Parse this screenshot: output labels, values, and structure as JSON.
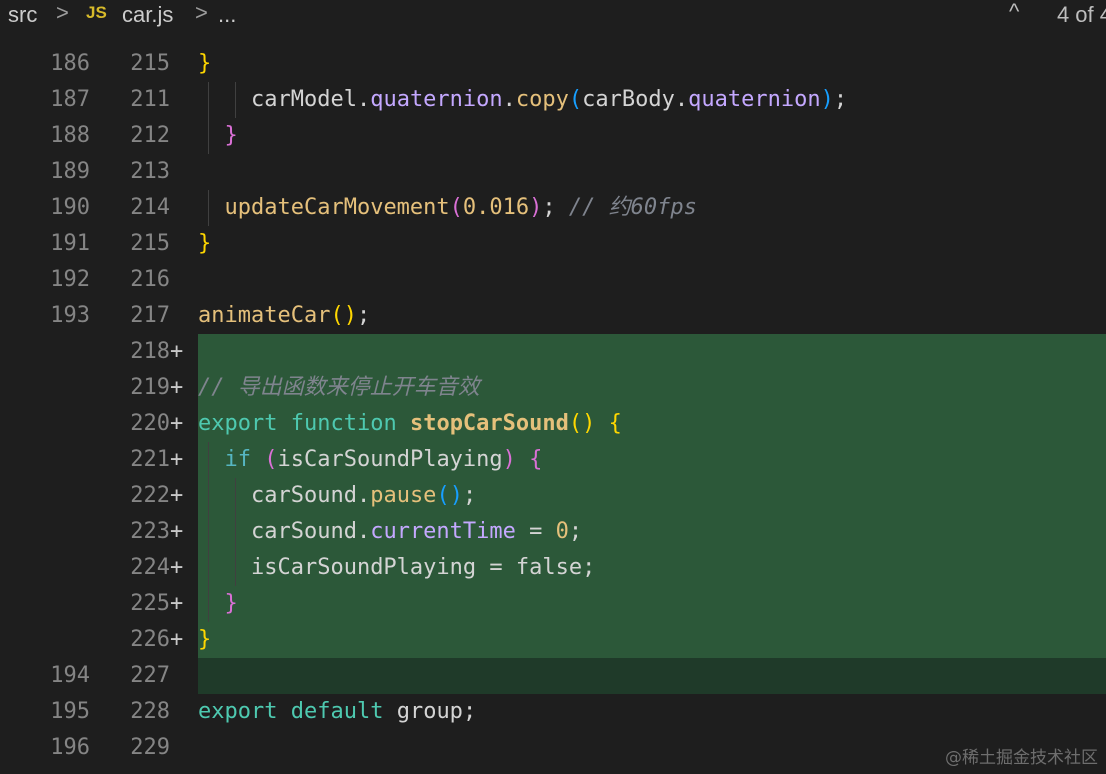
{
  "breadcrumb": {
    "folder": "src",
    "file_icon": "JS",
    "file": "car.js",
    "more": "...",
    "separator": ">"
  },
  "find": {
    "chevron": "^",
    "status": "4 of 4"
  },
  "lines": [
    {
      "old": "186",
      "new": "215",
      "added": false,
      "tokens": [
        [
          "}",
          "br1"
        ]
      ]
    },
    {
      "old": "187",
      "new": "211",
      "added": false,
      "indent": 2,
      "tokens": [
        [
          "carModel",
          "id"
        ],
        [
          ".",
          "id"
        ],
        [
          "quaternion",
          "prop"
        ],
        [
          ".",
          "id"
        ],
        [
          "copy",
          "fn"
        ],
        [
          "(",
          "br3"
        ],
        [
          "carBody",
          "id"
        ],
        [
          ".",
          "id"
        ],
        [
          "quaternion",
          "prop"
        ],
        [
          ")",
          "br3"
        ],
        [
          ";",
          "id"
        ]
      ]
    },
    {
      "old": "188",
      "new": "212",
      "added": false,
      "indent": 1,
      "tokens": [
        [
          "}",
          "br2"
        ]
      ]
    },
    {
      "old": "189",
      "new": "213",
      "added": false,
      "tokens": []
    },
    {
      "old": "190",
      "new": "214",
      "added": false,
      "indent": 1,
      "tokens": [
        [
          "updateCarMovement",
          "fn"
        ],
        [
          "(",
          "br2"
        ],
        [
          "0.016",
          "num"
        ],
        [
          ")",
          "br2"
        ],
        [
          "; ",
          "id"
        ],
        [
          "// 约60fps",
          "cmt"
        ]
      ]
    },
    {
      "old": "191",
      "new": "215",
      "added": false,
      "tokens": [
        [
          "}",
          "br1"
        ]
      ]
    },
    {
      "old": "192",
      "new": "216",
      "added": false,
      "tokens": []
    },
    {
      "old": "193",
      "new": "217",
      "added": false,
      "tokens": [
        [
          "animateCar",
          "fn"
        ],
        [
          "(",
          "br1"
        ],
        [
          ")",
          "br1"
        ],
        [
          ";",
          "id"
        ]
      ]
    },
    {
      "old": "",
      "new": "218",
      "added": true,
      "tokens": []
    },
    {
      "old": "",
      "new": "219",
      "added": true,
      "tokens": [
        [
          "// 导出函数来停止开车音效",
          "cmt"
        ]
      ]
    },
    {
      "old": "",
      "new": "220",
      "added": true,
      "tokens": [
        [
          "export",
          "kw"
        ],
        [
          " ",
          "id"
        ],
        [
          "function",
          "kw"
        ],
        [
          " ",
          "id"
        ],
        [
          "stopCarSound",
          "fnb"
        ],
        [
          "(",
          "br1"
        ],
        [
          ")",
          "br1"
        ],
        [
          " ",
          "id"
        ],
        [
          "{",
          "br1"
        ]
      ]
    },
    {
      "old": "",
      "new": "221",
      "added": true,
      "indent": 1,
      "tokens": [
        [
          "if",
          "ctrl"
        ],
        [
          " ",
          "id"
        ],
        [
          "(",
          "br2"
        ],
        [
          "isCarSoundPlaying",
          "id"
        ],
        [
          ")",
          "br2"
        ],
        [
          " ",
          "id"
        ],
        [
          "{",
          "br2"
        ]
      ]
    },
    {
      "old": "",
      "new": "222",
      "added": true,
      "indent": 2,
      "tokens": [
        [
          "carSound",
          "id"
        ],
        [
          ".",
          "id"
        ],
        [
          "pause",
          "fn"
        ],
        [
          "(",
          "br3"
        ],
        [
          ")",
          "br3"
        ],
        [
          ";",
          "id"
        ]
      ]
    },
    {
      "old": "",
      "new": "223",
      "added": true,
      "indent": 2,
      "tokens": [
        [
          "carSound",
          "id"
        ],
        [
          ".",
          "id"
        ],
        [
          "currentTime",
          "prop"
        ],
        [
          " = ",
          "id"
        ],
        [
          "0",
          "num"
        ],
        [
          ";",
          "id"
        ]
      ]
    },
    {
      "old": "",
      "new": "224",
      "added": true,
      "indent": 2,
      "tokens": [
        [
          "isCarSoundPlaying",
          "id"
        ],
        [
          " = ",
          "id"
        ],
        [
          "false",
          "id"
        ],
        [
          ";",
          "id"
        ]
      ]
    },
    {
      "old": "",
      "new": "225",
      "added": true,
      "indent": 1,
      "tokens": [
        [
          "}",
          "br2"
        ]
      ]
    },
    {
      "old": "",
      "new": "226",
      "added": true,
      "tokens": [
        [
          "}",
          "br1"
        ]
      ]
    },
    {
      "old": "194",
      "new": "227",
      "added": false,
      "tokens": [],
      "tint": true
    },
    {
      "old": "195",
      "new": "228",
      "added": false,
      "tokens": [
        [
          "export",
          "kw"
        ],
        [
          " ",
          "id"
        ],
        [
          "default",
          "kw"
        ],
        [
          " ",
          "id"
        ],
        [
          "group",
          "id"
        ],
        [
          ";",
          "id"
        ]
      ]
    },
    {
      "old": "196",
      "new": "229",
      "added": false,
      "tokens": []
    }
  ],
  "watermark": "@稀土掘金技术社区",
  "colors": {
    "background": "#1e1e1e",
    "added_line": "#2c5839",
    "line_number": "#858585"
  }
}
